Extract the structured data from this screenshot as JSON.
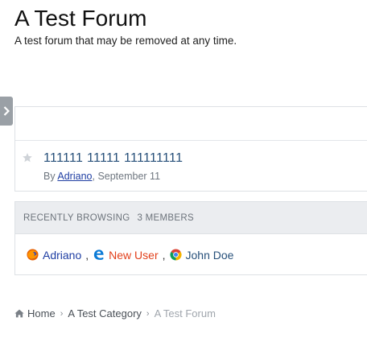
{
  "forum": {
    "title": "A Test Forum",
    "description": "A test forum that may be removed at any time."
  },
  "topics": [
    {
      "title": "111111 11111 111111111",
      "by_label": "By",
      "author": "Adriano",
      "date": "September 11"
    }
  ],
  "browsing": {
    "label": "Recently Browsing",
    "count": "3 members",
    "separator": ",",
    "members": [
      {
        "name": "Adriano",
        "browser_icon": "firefox-icon",
        "color": "#1f3ea3"
      },
      {
        "name": "New User",
        "browser_icon": "edge-icon",
        "color": "#e2401b"
      },
      {
        "name": "John Doe",
        "browser_icon": "chrome-icon",
        "color": "#27507a"
      }
    ]
  },
  "breadcrumb": {
    "home": "Home",
    "category": "A Test Category",
    "current": "A Test Forum"
  },
  "colors": {
    "link": "#27507a",
    "author": "#1f3ea3",
    "new_user": "#e2401b",
    "muted": "#a0a6ad"
  }
}
